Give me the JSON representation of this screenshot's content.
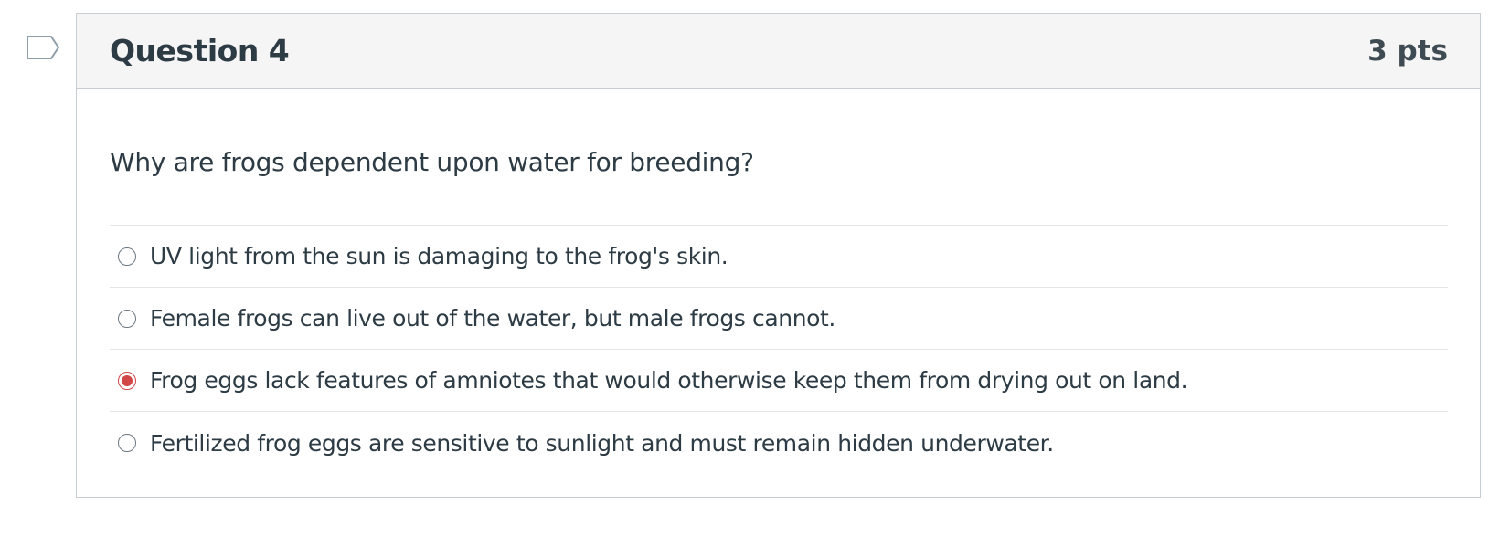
{
  "question": {
    "title": "Question 4",
    "points": "3 pts",
    "flag_icon": "bookmark-flag-icon",
    "text": "Why are frogs dependent upon water for breeding?",
    "answers": [
      {
        "label": "UV light from the sun is damaging to the frog's skin.",
        "selected": false
      },
      {
        "label": "Female frogs can live out of the water, but male frogs cannot.",
        "selected": false
      },
      {
        "label": "Frog eggs lack features of amniotes that would otherwise keep them from drying out on land.",
        "selected": true
      },
      {
        "label": "Fertilized frog eggs are sensitive to sunlight and must remain hidden underwater.",
        "selected": false
      }
    ]
  },
  "colors": {
    "selected_accent": "#d14646",
    "header_background": "#f5f5f5",
    "border": "#c7cdd1",
    "text": "#2d3b45"
  }
}
